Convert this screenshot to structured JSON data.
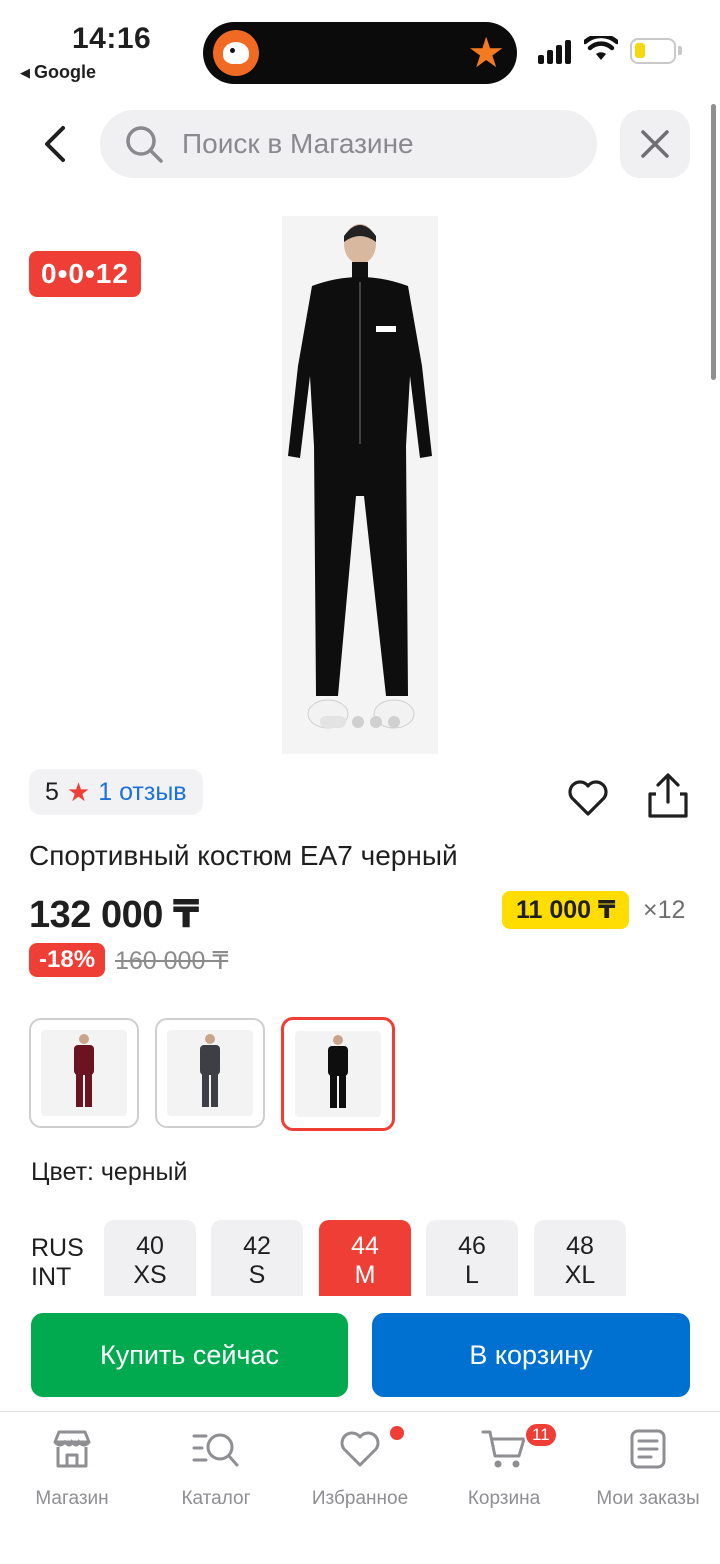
{
  "status_bar": {
    "time": "14:16",
    "back_app": "Google"
  },
  "search": {
    "placeholder": "Поиск в Магазине"
  },
  "product": {
    "timer": "0•0•12",
    "rating": "5",
    "reviews": "1 отзыв",
    "title": "Спортивный костюм EA7 черный",
    "price": "132 000 ₸",
    "installment_amount": "11 000 ₸",
    "installment_months": "×12",
    "discount": "-18%",
    "old_price": "160 000 ₸",
    "color_label": "Цвет: черный",
    "color_options": [
      "burgundy",
      "grey",
      "black"
    ],
    "selected_color": "black",
    "size_legend": [
      "RUS",
      "INT"
    ],
    "sizes": [
      {
        "rus": "40",
        "int": "XS"
      },
      {
        "rus": "42",
        "int": "S"
      },
      {
        "rus": "44",
        "int": "M"
      },
      {
        "rus": "46",
        "int": "L"
      },
      {
        "rus": "48",
        "int": "XL"
      }
    ],
    "selected_size": "44"
  },
  "actions": {
    "buy_now": "Купить сейчас",
    "add_to_cart": "В корзину"
  },
  "tab_bar": {
    "items": [
      {
        "label": "Магазин",
        "icon": "shop-icon"
      },
      {
        "label": "Каталог",
        "icon": "catalog-search-icon"
      },
      {
        "label": "Избранное",
        "icon": "heart-icon"
      },
      {
        "label": "Корзина",
        "icon": "cart-icon"
      },
      {
        "label": "Мои заказы",
        "icon": "orders-icon"
      }
    ],
    "cart_count": "11"
  },
  "colors": {
    "accent_red": "#ef3e36",
    "buy_green": "#01aa4f",
    "cart_blue": "#0071d0",
    "installment_yellow": "#ffdd00",
    "link_blue": "#1a73d9"
  }
}
